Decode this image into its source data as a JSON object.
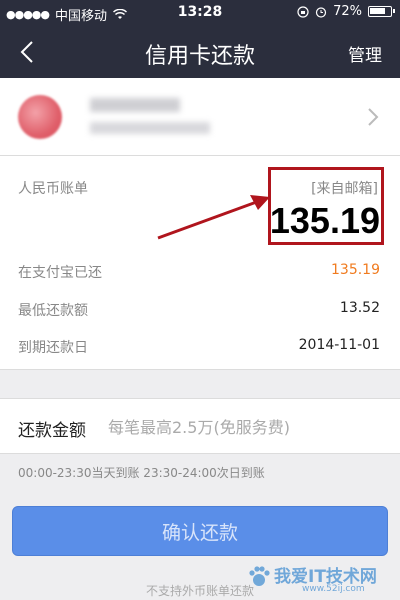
{
  "status_bar": {
    "carrier": "中国移动",
    "time": "13:28",
    "battery": "72%"
  },
  "nav": {
    "title": "信用卡还款",
    "manage_label": "管理"
  },
  "bill": {
    "label": "人民币账单",
    "source": "[来自邮箱]",
    "amount": "135.19",
    "rows": [
      {
        "label": "在支付宝已还",
        "value": "135.19"
      },
      {
        "label": "最低还款额",
        "value": "13.52"
      },
      {
        "label": "到期还款日",
        "value": "2014-11-01"
      }
    ]
  },
  "payment": {
    "label": "还款金额",
    "placeholder": "每笔最高2.5万(免服务费)"
  },
  "time_note": "00:00-23:30当天到账  23:30-24:00次日到账",
  "confirm_label": "确认还款",
  "foot_note": "不支持外币账单还款",
  "watermark": {
    "text": "我爱IT技术网",
    "url": "www.52ij.com"
  },
  "colors": {
    "nav_bg": "#2b2e3d",
    "accent_orange": "#f07b1f",
    "button_blue": "#5a8ee8",
    "highlight_red": "#b0151d"
  }
}
